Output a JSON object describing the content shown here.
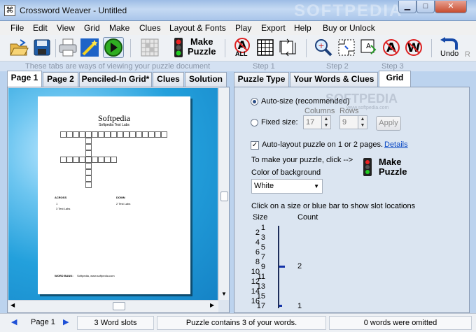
{
  "window": {
    "title": "Crossword Weaver  -  Untitled",
    "watermark": "SOFTPEDIA"
  },
  "menu": [
    "File",
    "Edit",
    "View",
    "Grid",
    "Make",
    "Clues",
    "Layout & Fonts",
    "Play",
    "Export",
    "Help",
    "Buy or Unlock"
  ],
  "toolbar": {
    "make_puzzle_l1": "Make",
    "make_puzzle_l2": "Puzzle",
    "undo": "Undo",
    "all_badge": "ALL"
  },
  "hints": {
    "tabs_hint": "These tabs are ways of viewing your puzzle document",
    "step1": "Step 1",
    "step2": "Step 2",
    "step3": "Step 3"
  },
  "left_tabs": [
    "Page 1",
    "Page 2",
    "Penciled-In Grid*",
    "Clues",
    "Solution"
  ],
  "right_tabs": [
    "Puzzle Type",
    "Your Words & Clues",
    "Grid"
  ],
  "preview": {
    "title": "Softpedia",
    "subtitle": "Softpedia Test Labs",
    "across": "ACROSS",
    "down": "DOWN",
    "across_clue_1": "1",
    "across_clue_2": "3  Test Labs",
    "down_clue": "2  Test Labs",
    "word_bank": "WORD BANK:",
    "word_bank_values": "Softpedia, www.softpedia.com"
  },
  "grid": {
    "autosize_label": "Auto-size (recommended)",
    "fixed_label": "Fixed size:",
    "columns_label": "Columns",
    "rows_label": "Rows",
    "columns_value": "17",
    "rows_value": "9",
    "apply": "Apply",
    "autolayout_label": "Auto-layout puzzle on 1 or 2 pages.",
    "details_link": "Details",
    "make_hint": "To make your puzzle, click -->",
    "make_l1": "Make",
    "make_l2": "Puzzle",
    "bg_label": "Color of background",
    "bg_value": "White",
    "slot_hint": "Click on a size or blue bar to show slot locations",
    "size_header": "Size",
    "count_header": "Count",
    "sizes": [
      "1",
      "2",
      "3",
      "4",
      "5",
      "6",
      "7",
      "8",
      "9",
      "10",
      "11",
      "12",
      "13",
      "14",
      "15",
      "16",
      "17"
    ],
    "count_9": "2",
    "count_17": "1",
    "softpedia_wm": "SOFTPEDIA",
    "softpedia_url": "www.softpedia.com"
  },
  "status": {
    "page": "Page 1",
    "slots": "3 Word slots",
    "contains": "Puzzle contains 3 of your words.",
    "omitted": "0 words were omitted"
  }
}
